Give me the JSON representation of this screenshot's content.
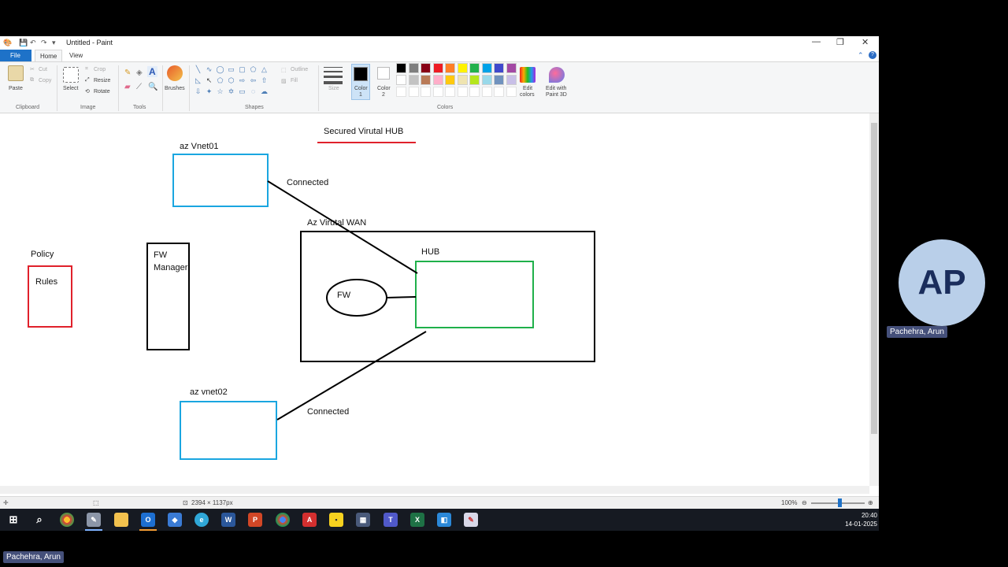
{
  "window": {
    "title": "Untitled - Paint",
    "minimize": "—",
    "restore": "❐",
    "close": "✕"
  },
  "menu": {
    "file": "File",
    "tabs": [
      "Home",
      "View"
    ],
    "active_tab": "Home"
  },
  "ribbon": {
    "clipboard": {
      "paste": "Paste",
      "cut": "Cut",
      "copy": "Copy",
      "label": "Clipboard"
    },
    "image": {
      "select": "Select",
      "crop": "Crop",
      "resize": "Resize",
      "rotate": "Rotate",
      "label": "Image"
    },
    "tools": {
      "label": "Tools",
      "text_tool": "A"
    },
    "brushes": {
      "label": "Brushes"
    },
    "shapes": {
      "outline": "Outline",
      "fill": "Fill",
      "label": "Shapes"
    },
    "size": {
      "label": "Size"
    },
    "color1": {
      "label1": "Color",
      "label2": "1"
    },
    "color2": {
      "label1": "Color",
      "label2": "2"
    },
    "colors": {
      "label": "Colors",
      "row1": [
        "#000000",
        "#7f7f7f",
        "#880015",
        "#ed1c24",
        "#ff7f27",
        "#fff200",
        "#22b14c",
        "#00a2e8",
        "#3f48cc",
        "#a349a4"
      ],
      "row2": [
        "#ffffff",
        "#c3c3c3",
        "#b97a57",
        "#ffaec9",
        "#ffc90e",
        "#efe4b0",
        "#b5e61d",
        "#99d9ea",
        "#7092be",
        "#c8bfe7"
      ]
    },
    "edit_colors": {
      "line1": "Edit",
      "line2": "colors"
    },
    "edit_paint3d": {
      "line1": "Edit with",
      "line2": "Paint 3D"
    }
  },
  "canvas": {
    "title": "Secured Virutal HUB",
    "vnet01": "az Vnet01",
    "vnet02": "az vnet02",
    "connected_top": "Connected",
    "connected_bottom": "Connected",
    "wan": "Az Virutal WAN",
    "hub": "HUB",
    "fw": "FW",
    "policy": "Policy",
    "rules": "Rules",
    "fw_manager_line1": "FW",
    "fw_manager_line2": "Manager",
    "colors": {
      "vnet": "#1aa6e0",
      "hub": "#1fb04a",
      "policy": "#e0212b",
      "underline": "#e0212b",
      "ink": "#000000"
    }
  },
  "statusbar": {
    "dimensions": "2394 × 1137px",
    "zoom": "100%"
  },
  "taskbar": {
    "time": "20:40",
    "date": "14-01-2025"
  },
  "participant": {
    "initials": "AP",
    "name": "Pachehra, Arun"
  },
  "self_view": {
    "name": "Pachehra, Arun"
  }
}
